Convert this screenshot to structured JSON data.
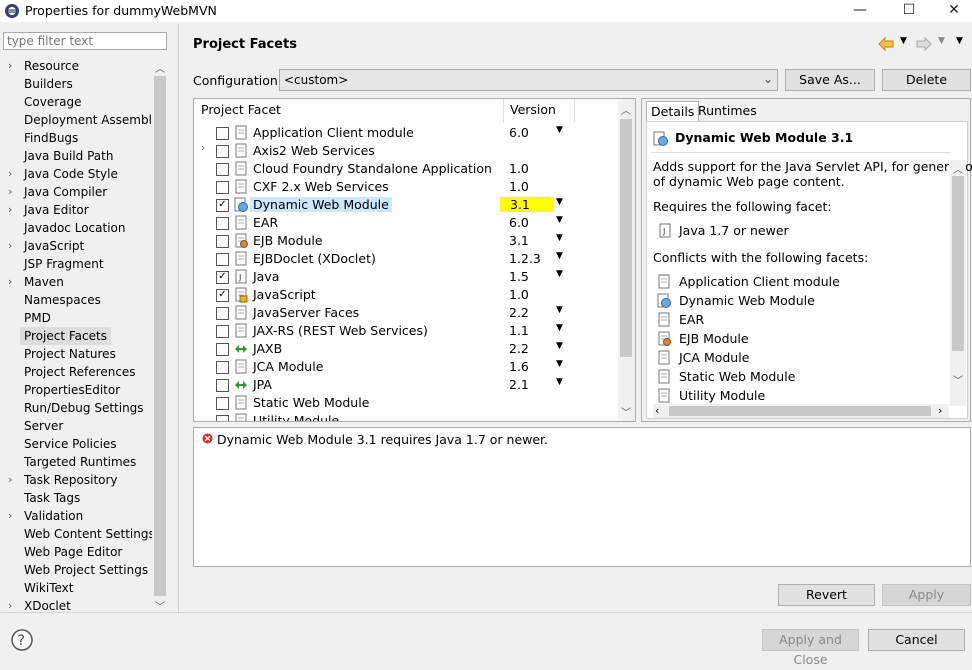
{
  "window": {
    "title": "Properties for dummyWebMVN",
    "minimize": "—",
    "maximize": "☐",
    "close": "✕"
  },
  "filter": {
    "placeholder": "type filter text"
  },
  "tree": {
    "items": [
      {
        "label": "Resource",
        "expandable": true
      },
      {
        "label": "Builders",
        "expandable": false
      },
      {
        "label": "Coverage",
        "expandable": false
      },
      {
        "label": "Deployment Assembly",
        "expandable": false
      },
      {
        "label": "FindBugs",
        "expandable": false
      },
      {
        "label": "Java Build Path",
        "expandable": false
      },
      {
        "label": "Java Code Style",
        "expandable": true
      },
      {
        "label": "Java Compiler",
        "expandable": true
      },
      {
        "label": "Java Editor",
        "expandable": true
      },
      {
        "label": "Javadoc Location",
        "expandable": false
      },
      {
        "label": "JavaScript",
        "expandable": true
      },
      {
        "label": "JSP Fragment",
        "expandable": false
      },
      {
        "label": "Maven",
        "expandable": true
      },
      {
        "label": "Namespaces",
        "expandable": false
      },
      {
        "label": "PMD",
        "expandable": false
      },
      {
        "label": "Project Facets",
        "expandable": false,
        "selected": true
      },
      {
        "label": "Project Natures",
        "expandable": false
      },
      {
        "label": "Project References",
        "expandable": false
      },
      {
        "label": "PropertiesEditor",
        "expandable": false
      },
      {
        "label": "Run/Debug Settings",
        "expandable": false
      },
      {
        "label": "Server",
        "expandable": false
      },
      {
        "label": "Service Policies",
        "expandable": false
      },
      {
        "label": "Targeted Runtimes",
        "expandable": false
      },
      {
        "label": "Task Repository",
        "expandable": true
      },
      {
        "label": "Task Tags",
        "expandable": false
      },
      {
        "label": "Validation",
        "expandable": true
      },
      {
        "label": "Web Content Settings",
        "expandable": false
      },
      {
        "label": "Web Page Editor",
        "expandable": false
      },
      {
        "label": "Web Project Settings",
        "expandable": false
      },
      {
        "label": "WikiText",
        "expandable": false
      },
      {
        "label": "XDoclet",
        "expandable": true
      }
    ]
  },
  "page": {
    "title": "Project Facets",
    "config_label": "Configuration:",
    "config_value": "<custom>",
    "save_as": "Save As...",
    "delete": "Delete"
  },
  "facets": {
    "col_facet": "Project Facet",
    "col_version": "Version",
    "rows": [
      {
        "name": "Application Client module",
        "version": "6.0",
        "checked": false,
        "dropdown": true,
        "expandable": false,
        "icon": "doc-icon"
      },
      {
        "name": "Axis2 Web Services",
        "version": "",
        "checked": false,
        "dropdown": false,
        "expandable": true,
        "icon": "doc-icon"
      },
      {
        "name": "Cloud Foundry Standalone Application",
        "version": "1.0",
        "checked": false,
        "dropdown": false,
        "expandable": false,
        "icon": "doc-icon"
      },
      {
        "name": "CXF 2.x Web Services",
        "version": "1.0",
        "checked": false,
        "dropdown": false,
        "expandable": false,
        "icon": "doc-icon"
      },
      {
        "name": "Dynamic Web Module",
        "version": "3.1",
        "checked": true,
        "dropdown": true,
        "expandable": false,
        "icon": "globe-icon",
        "selected": true
      },
      {
        "name": "EAR",
        "version": "6.0",
        "checked": false,
        "dropdown": true,
        "expandable": false,
        "icon": "doc-icon"
      },
      {
        "name": "EJB Module",
        "version": "3.1",
        "checked": false,
        "dropdown": true,
        "expandable": false,
        "icon": "bean-icon"
      },
      {
        "name": "EJBDoclet (XDoclet)",
        "version": "1.2.3",
        "checked": false,
        "dropdown": true,
        "expandable": false,
        "icon": "doc-icon"
      },
      {
        "name": "Java",
        "version": "1.5",
        "checked": true,
        "dropdown": true,
        "expandable": false,
        "icon": "java-icon"
      },
      {
        "name": "JavaScript",
        "version": "1.0",
        "checked": true,
        "dropdown": false,
        "expandable": false,
        "icon": "lock-doc-icon"
      },
      {
        "name": "JavaServer Faces",
        "version": "2.2",
        "checked": false,
        "dropdown": true,
        "expandable": false,
        "icon": "doc-icon"
      },
      {
        "name": "JAX-RS (REST Web Services)",
        "version": "1.1",
        "checked": false,
        "dropdown": true,
        "expandable": false,
        "icon": "doc-icon"
      },
      {
        "name": "JAXB",
        "version": "2.2",
        "checked": false,
        "dropdown": true,
        "expandable": false,
        "icon": "arrows-icon"
      },
      {
        "name": "JCA Module",
        "version": "1.6",
        "checked": false,
        "dropdown": true,
        "expandable": false,
        "icon": "doc-icon"
      },
      {
        "name": "JPA",
        "version": "2.1",
        "checked": false,
        "dropdown": true,
        "expandable": false,
        "icon": "arrows-icon"
      },
      {
        "name": "Static Web Module",
        "version": "",
        "checked": false,
        "dropdown": false,
        "expandable": false,
        "icon": "doc-icon"
      },
      {
        "name": "Utility Module",
        "version": "",
        "checked": false,
        "dropdown": false,
        "expandable": false,
        "icon": "doc-icon"
      }
    ]
  },
  "details": {
    "tab_details": "Details",
    "tab_runtimes": "Runtimes",
    "heading": "Dynamic Web Module 3.1",
    "desc1": "Adds support for the Java Servlet API, for generation",
    "desc2": "of dynamic Web page content.",
    "requires_label": "Requires the following facet:",
    "requires_item": "Java 1.7 or newer",
    "conflicts_label": "Conflicts with the following facets:",
    "conflicts": [
      "Application Client module",
      "Dynamic Web Module",
      "EAR",
      "EJB Module",
      "JCA Module",
      "Static Web Module",
      "Utility Module"
    ]
  },
  "messages": {
    "error": "Dynamic Web Module 3.1 requires Java 1.7 or newer."
  },
  "buttons": {
    "revert": "Revert",
    "apply": "Apply",
    "apply_close": "Apply and Close",
    "cancel": "Cancel"
  },
  "colors": {
    "highlight": "#ffff00",
    "selection": "#cce8ff",
    "error": "#d9302c"
  }
}
